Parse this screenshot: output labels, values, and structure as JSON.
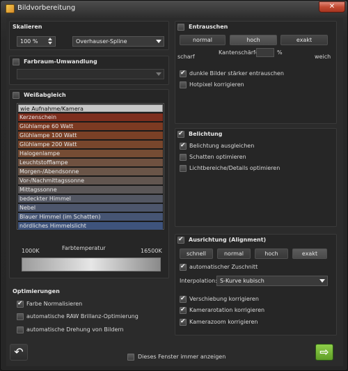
{
  "window": {
    "title": "Bildvorbereitung",
    "close_glyph": "✕"
  },
  "scale": {
    "header": "Skalieren",
    "percent_value": "100 %",
    "method_value": "Overhauser-Spline"
  },
  "colorspace": {
    "header": "Farbraum-Umwandlung",
    "checked": false,
    "dropdown_value": ""
  },
  "whitebalance": {
    "header": "Weißabgleich",
    "checked": false,
    "items": [
      {
        "label": "wie Aufnahme/Kamera",
        "color": "#c8c8c8"
      },
      {
        "label": "Kerzenschein",
        "color": "#7d2e1e"
      },
      {
        "label": "Glühlampe 60 Watt",
        "color": "#7c3a22"
      },
      {
        "label": "Glühlampe 100 Watt",
        "color": "#7a4026"
      },
      {
        "label": "Glühlampe 200 Watt",
        "color": "#78462c"
      },
      {
        "label": "Halogenlampe",
        "color": "#754c34"
      },
      {
        "label": "Leuchtstofflampe",
        "color": "#6f5140"
      },
      {
        "label": "Morgen-/Abendsonne",
        "color": "#6a5548"
      },
      {
        "label": "Vor-/Nachmittagssonne",
        "color": "#625650"
      },
      {
        "label": "Mittagssonne",
        "color": "#5b5758"
      },
      {
        "label": "bedeckter Himmel",
        "color": "#535763"
      },
      {
        "label": "Nebel",
        "color": "#4d566c"
      },
      {
        "label": "Blauer Himmel (im Schatten)",
        "color": "#465574"
      },
      {
        "label": "nördliches Himmelslicht",
        "color": "#3e537c"
      }
    ],
    "temperature_label": "Farbtemperatur",
    "temp_min": "1000K",
    "temp_max": "16500K"
  },
  "optimizations": {
    "header": "Optimierungen",
    "options": [
      {
        "label": "Farbe Normalisieren",
        "checked": true
      },
      {
        "label": "automatische RAW Brillanz-Optimierung",
        "checked": false
      },
      {
        "label": "automatische Drehung von Bildern",
        "checked": false
      }
    ]
  },
  "denoise": {
    "header": "Entrauschen",
    "checked": false,
    "levels": [
      "normal",
      "hoch",
      "exakt"
    ],
    "selected_level": "hoch",
    "edge_label": "Kantenschärfe",
    "edge_unit": "%",
    "sharp_label": "scharf",
    "soft_label": "weich",
    "options": [
      {
        "label": "dunkle Bilder stärker entrauschen",
        "checked": true
      },
      {
        "label": "Hotpixel korrigieren",
        "checked": false
      }
    ]
  },
  "exposure": {
    "header": "Belichtung",
    "checked": true,
    "options": [
      {
        "label": "Belichtung ausgleichen",
        "checked": true
      },
      {
        "label": "Schatten optimieren",
        "checked": false
      },
      {
        "label": "Lichtbereiche/Details optimieren",
        "checked": false
      }
    ]
  },
  "alignment": {
    "header": "Ausrichtung (Alignment)",
    "checked": true,
    "levels": [
      "schnell",
      "normal",
      "hoch",
      "exakt"
    ],
    "selected_level": "exakt",
    "autocrop": {
      "label": "automatischer Zuschnitt",
      "checked": true
    },
    "interpolation_label": "Interpolation:",
    "interpolation_value": "S-Kurve kubisch",
    "options": [
      {
        "label": "Verschiebung korrigieren",
        "checked": true
      },
      {
        "label": "Kamerarotation korrigieren",
        "checked": true
      },
      {
        "label": "Kamerazoom korrigieren",
        "checked": true
      }
    ]
  },
  "footer": {
    "always_show_label": "Dieses Fenster immer anzeigen",
    "always_show_checked": false,
    "back_glyph": "↶",
    "next_glyph": "⇨"
  }
}
